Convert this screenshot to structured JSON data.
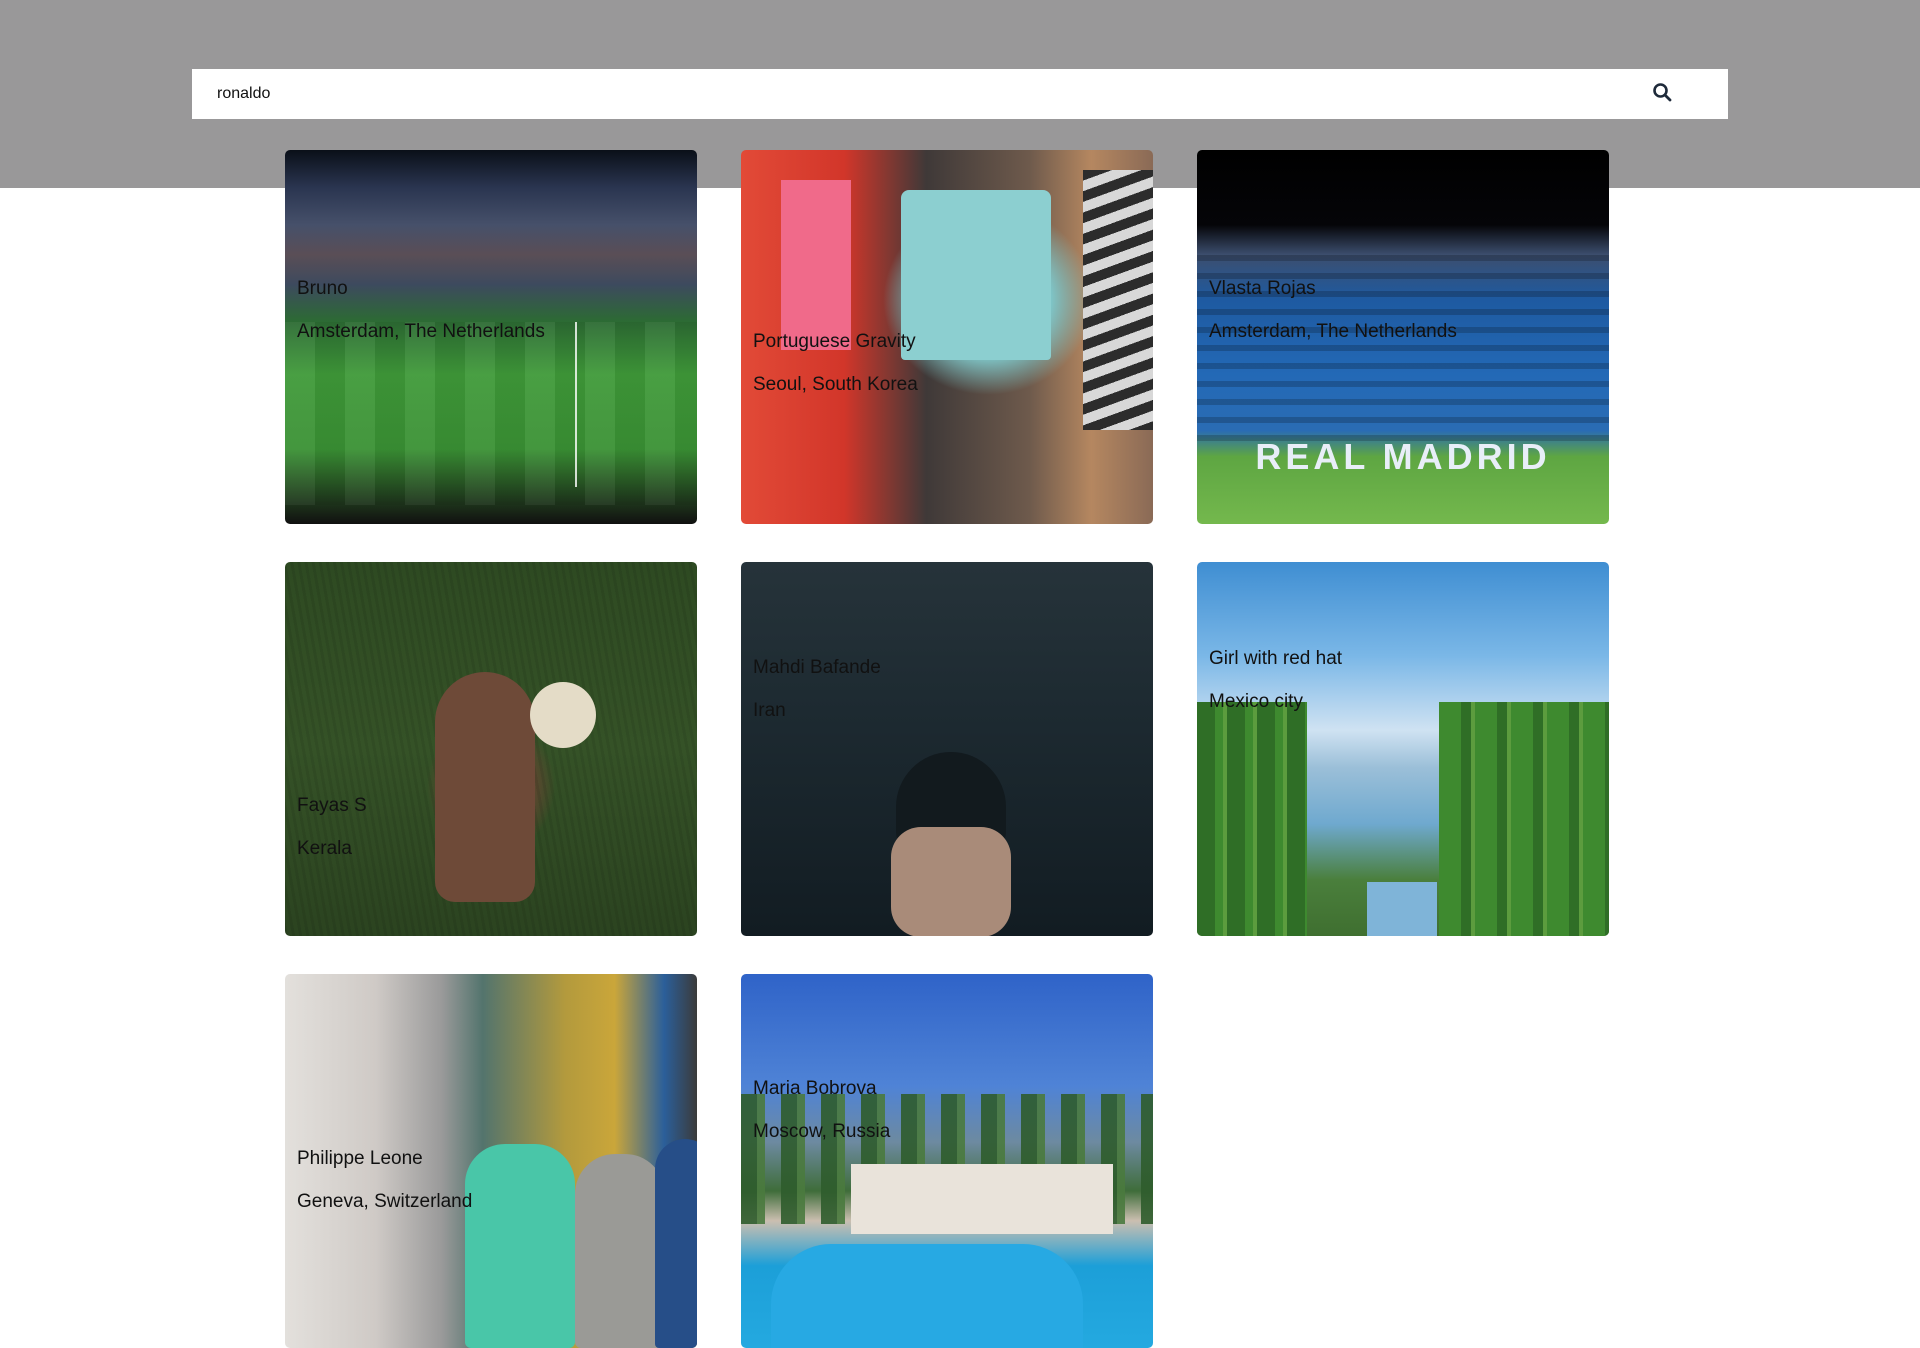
{
  "search": {
    "value": "ronaldo",
    "icon": "search-icon"
  },
  "results": [
    {
      "name": "Bruno",
      "location": "Amsterdam, The Netherlands"
    },
    {
      "name": "Portuguese Gravity",
      "location": "Seoul, South Korea"
    },
    {
      "name": "Vlasta Rojas",
      "location": "Amsterdam, The Netherlands"
    },
    {
      "name": "Fayas S",
      "location": "Kerala"
    },
    {
      "name": "Mahdi Bafande",
      "location": "Iran"
    },
    {
      "name": "Girl with red hat",
      "location": "Mexico city"
    },
    {
      "name": "Philippe Leone",
      "location": "Geneva, Switzerland"
    },
    {
      "name": "Maria Bobrova",
      "location": "Moscow, Russia"
    }
  ],
  "colors": {
    "header_band": "#999899",
    "search_bg": "#ffffff",
    "caption_text": "#111111"
  }
}
